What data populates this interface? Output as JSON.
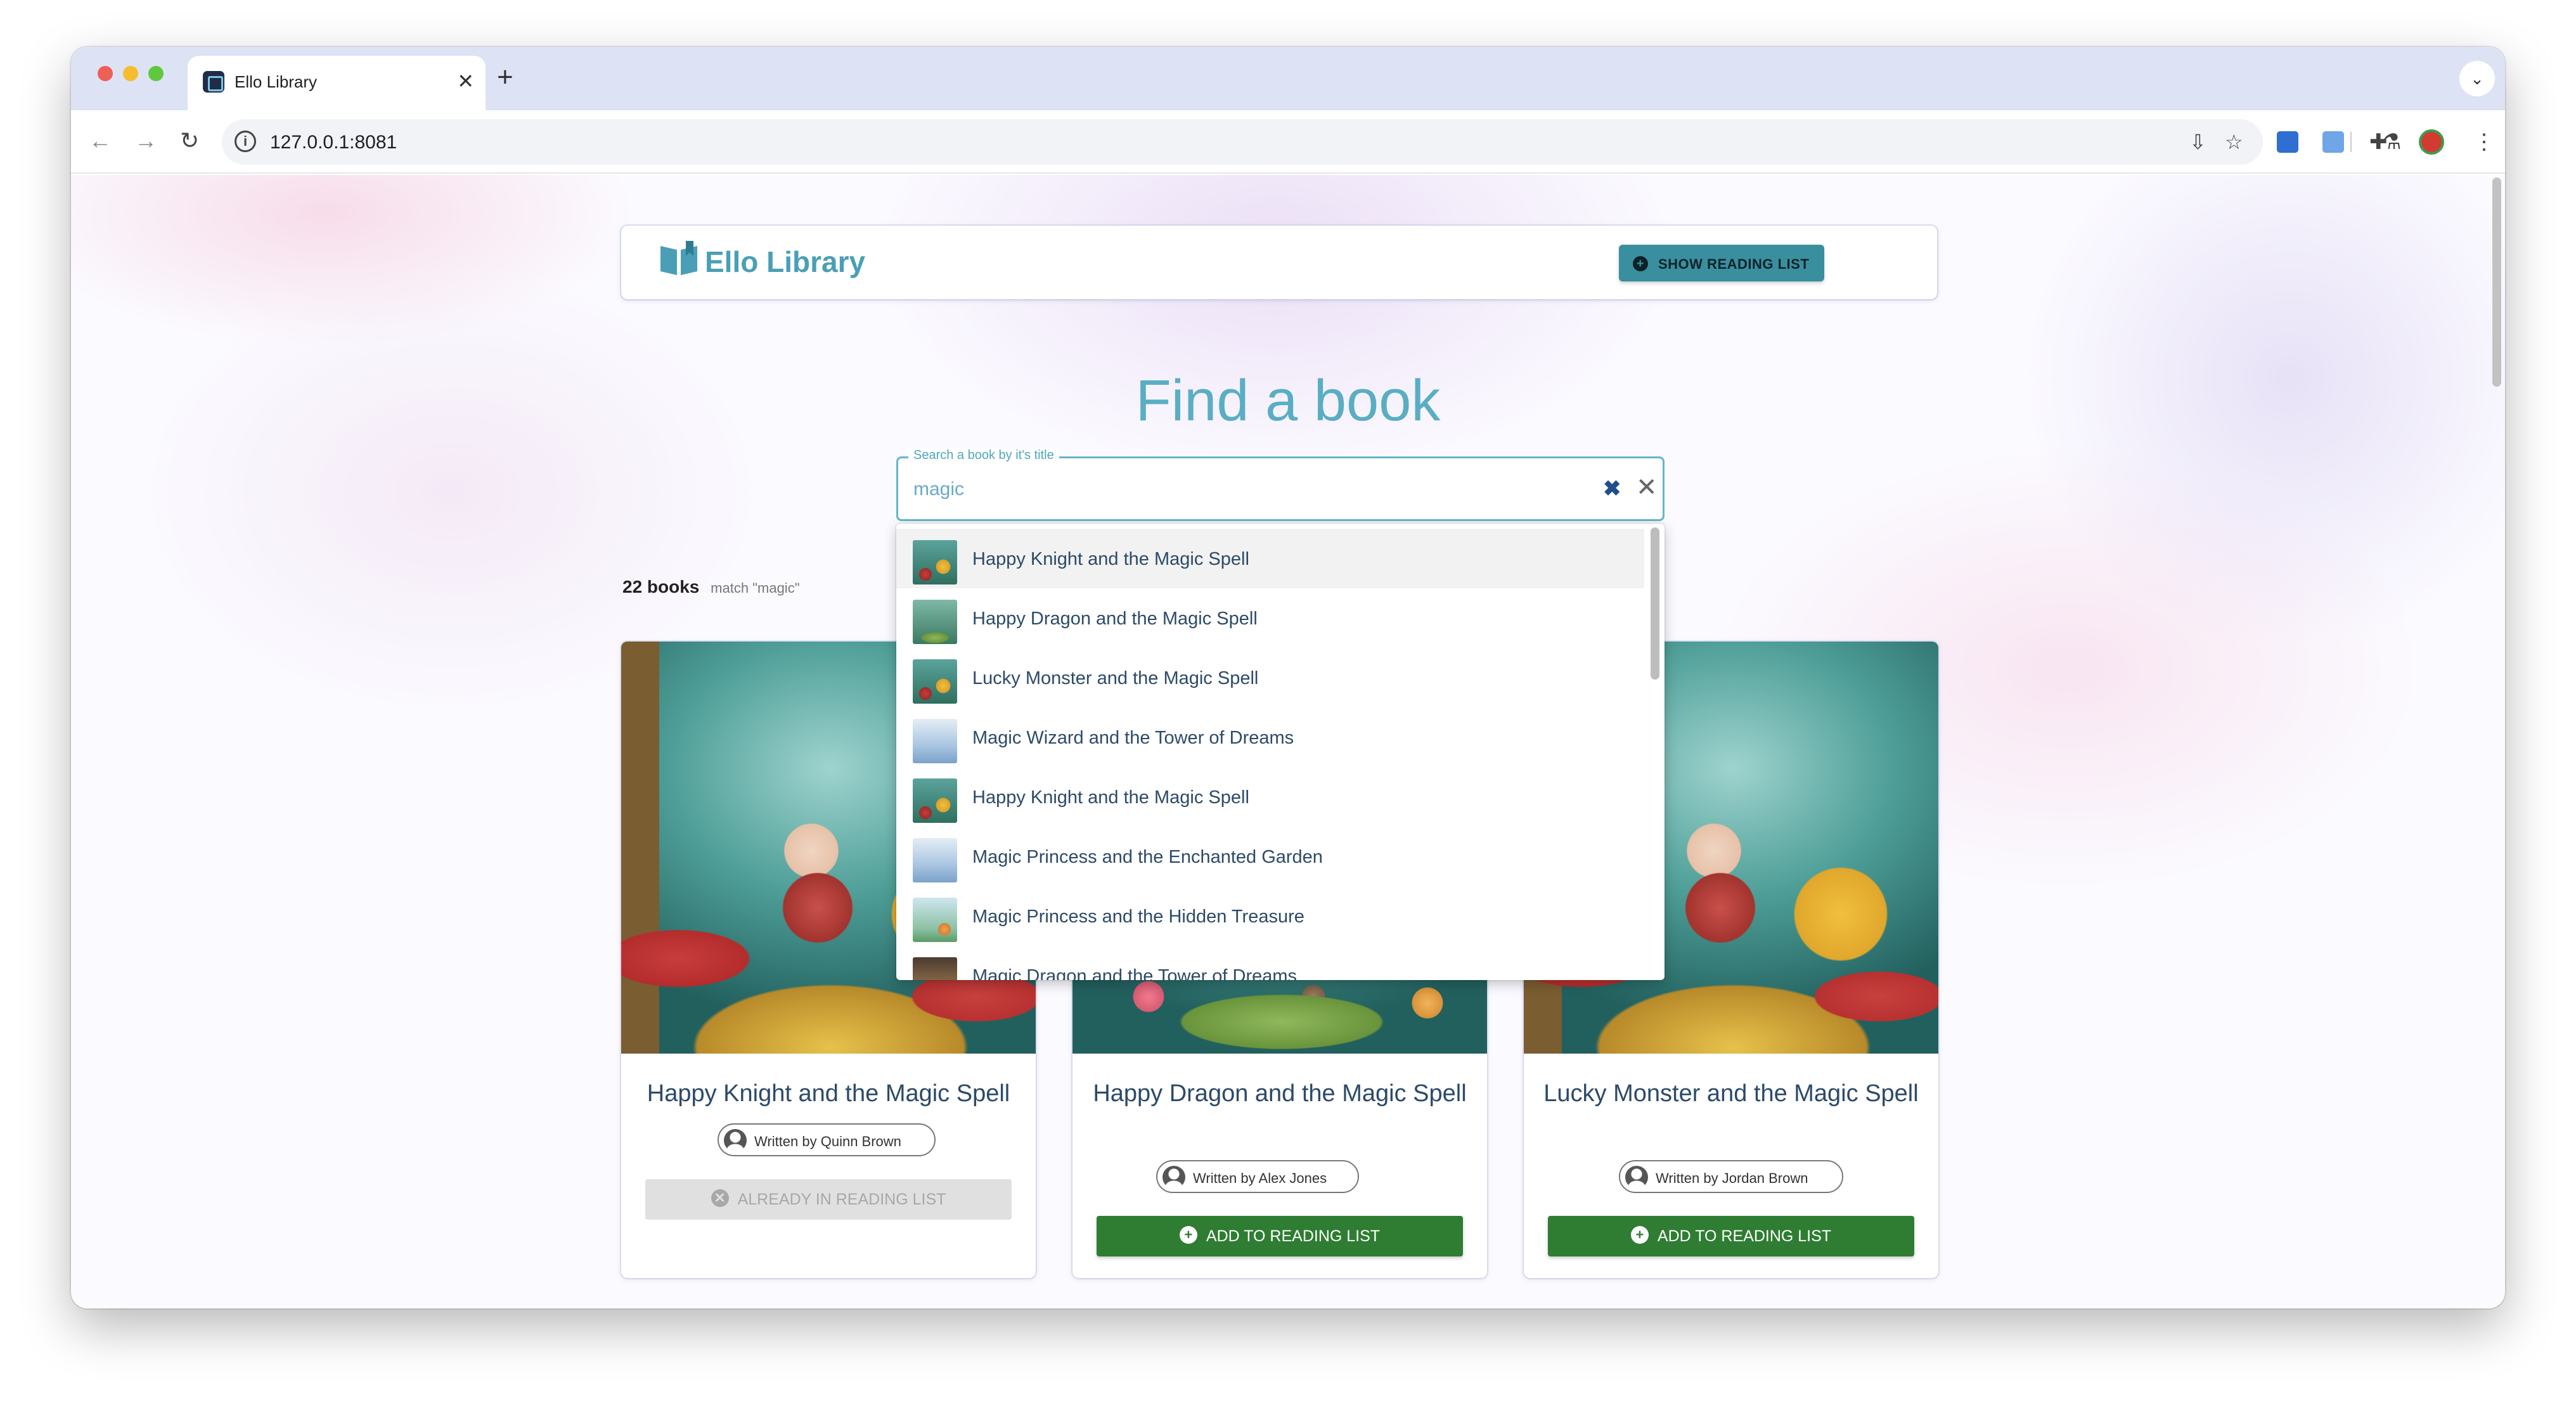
{
  "browser": {
    "tab_title": "Ello Library",
    "tab_close": "✕",
    "new_tab": "+",
    "tabs_menu": "⌄",
    "url": "127.0.0.1:8081",
    "nav": {
      "back": "←",
      "forward": "→",
      "reload": "↻"
    },
    "info": "i"
  },
  "header": {
    "logo_text": "Ello Library",
    "show_button_label": "SHOW READING LIST"
  },
  "main": {
    "title": "Find a book",
    "search": {
      "label": "Search a book by it's title",
      "value": "magic",
      "clear_icon": "✖",
      "close_icon": "✕"
    },
    "result_count": "22 books",
    "result_match": "match \"magic\""
  },
  "dropdown": {
    "items": [
      {
        "label": "Happy Knight and the Magic Spell",
        "thumb": "magic"
      },
      {
        "label": "Happy Dragon and the Magic Spell",
        "thumb": "dragon"
      },
      {
        "label": "Lucky Monster and the Magic Spell",
        "thumb": "magic"
      },
      {
        "label": "Magic Wizard and the Tower of Dreams",
        "thumb": "snow"
      },
      {
        "label": "Happy Knight and the Magic Spell",
        "thumb": "magic"
      },
      {
        "label": "Magic Princess and the Enchanted Garden",
        "thumb": "snow"
      },
      {
        "label": "Magic Princess and the Hidden Treasure",
        "thumb": "garden"
      },
      {
        "label": "Magic Dragon and the Tower of Dreams",
        "thumb": "tower"
      }
    ]
  },
  "cards": [
    {
      "title": "Happy Knight and the Magic Spell",
      "author": "Written by Quinn Brown",
      "button": "ALREADY IN READING LIST",
      "button_icon": "✕",
      "status": "disabled"
    },
    {
      "title": "Happy Dragon and the Magic Spell",
      "author": "Written by Alex Jones",
      "button": "ADD TO READING LIST",
      "button_icon": "+",
      "status": "add"
    },
    {
      "title": "Lucky Monster and the Magic Spell",
      "author": "Written by Jordan Brown",
      "button": "ADD TO READING LIST",
      "button_icon": "+",
      "status": "add"
    }
  ],
  "colors": {
    "accent": "#4a9fb6",
    "show_button": "#3a8f9f",
    "add_button": "#2e7d32",
    "disabled_button": "#e0e0e0"
  },
  "icons": {
    "book_logo": "book-open-icon",
    "avatar": "person-icon",
    "star": "☆",
    "install": "⇩",
    "puzzle": "✚",
    "flask": "⚗",
    "more": "⋮"
  }
}
